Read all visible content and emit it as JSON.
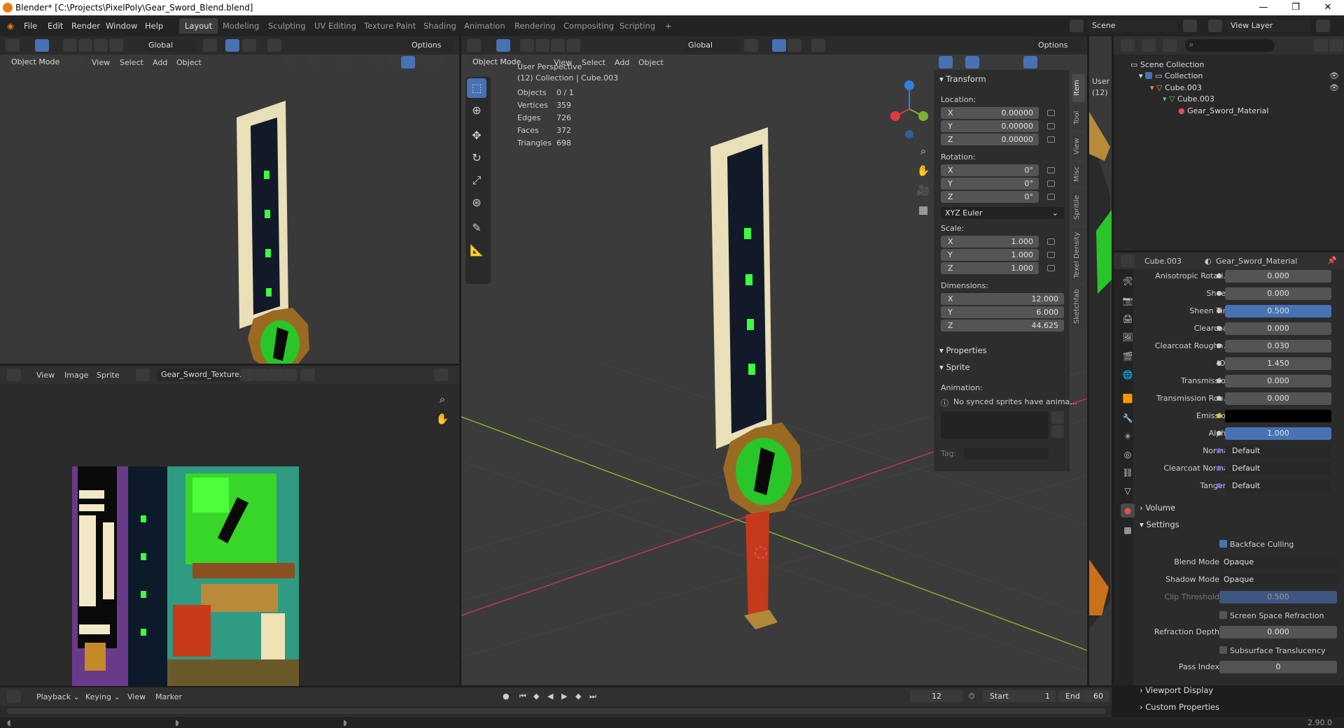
{
  "window": {
    "title": "Blender* [C:\\Projects\\PixelPoly\\Gear_Sword_Blend.blend]",
    "minimize": "—",
    "maximize": "❐",
    "close": "✕"
  },
  "menus": [
    "File",
    "Edit",
    "Render",
    "Window",
    "Help"
  ],
  "workspaces": [
    "Layout",
    "Modeling",
    "Sculpting",
    "UV Editing",
    "Texture Paint",
    "Shading",
    "Animation",
    "Rendering",
    "Compositing",
    "Scripting",
    "+"
  ],
  "scene": {
    "label": "Scene",
    "view_layer": "View Layer"
  },
  "left_viewport": {
    "transform": "Global",
    "options": "Options",
    "mode": "Object Mode",
    "menus": [
      "View",
      "Select",
      "Add",
      "Object"
    ]
  },
  "image_editor": {
    "menus": [
      "View",
      "Image",
      "Sprite"
    ],
    "image_name": "Gear_Sword_Texture..."
  },
  "main_viewport": {
    "transform": "Global",
    "options": "Options",
    "mode": "Object Mode",
    "menus": [
      "View",
      "Select",
      "Add",
      "Object"
    ],
    "perspective": "User Perspective",
    "collection": "(12) Collection | Cube.003",
    "stats": [
      {
        "k": "Objects",
        "v": "0 / 1"
      },
      {
        "k": "Vertices",
        "v": "359"
      },
      {
        "k": "Edges",
        "v": "726"
      },
      {
        "k": "Faces",
        "v": "372"
      },
      {
        "k": "Triangles",
        "v": "698"
      }
    ],
    "gizmo_colors": {
      "x": "#e0393e",
      "y": "#7ab332",
      "z": "#2f7fe0"
    }
  },
  "npanel": {
    "transform_title": "Transform",
    "location_label": "Location:",
    "location": [
      {
        "axis": "X",
        "value": "0.00000"
      },
      {
        "axis": "Y",
        "value": "0.00000"
      },
      {
        "axis": "Z",
        "value": "0.00000"
      }
    ],
    "rotation_label": "Rotation:",
    "rotation": [
      {
        "axis": "X",
        "value": "0°"
      },
      {
        "axis": "Y",
        "value": "0°"
      },
      {
        "axis": "Z",
        "value": "0°"
      }
    ],
    "rotation_mode": "XYZ Euler",
    "scale_label": "Scale:",
    "scale": [
      {
        "axis": "X",
        "value": "1.000"
      },
      {
        "axis": "Y",
        "value": "1.000"
      },
      {
        "axis": "Z",
        "value": "1.000"
      }
    ],
    "dimensions_label": "Dimensions:",
    "dimensions": [
      {
        "axis": "X",
        "value": "12.000"
      },
      {
        "axis": "Y",
        "value": "6.000"
      },
      {
        "axis": "Z",
        "value": "44.625"
      }
    ],
    "properties_title": "Properties",
    "sprite_title": "Sprite",
    "animation_label": "Animation:",
    "no_sprites": "No synced sprites have anima...",
    "tag_label": "Tag:",
    "tabs": [
      "Item",
      "Tool",
      "View",
      "Misc",
      "Spritile",
      "Texel Density",
      "Sketchfab"
    ]
  },
  "outliner": {
    "viewport_label": "User",
    "viewport_label2": "(12)",
    "items": [
      {
        "label": "Scene Collection"
      },
      {
        "label": "Collection"
      },
      {
        "label": "Cube.003"
      },
      {
        "label": "Cube.003"
      },
      {
        "label": "Gear_Sword_Material"
      }
    ]
  },
  "properties": {
    "object": "Cube.003",
    "material": "Gear_Sword_Material",
    "rows": [
      {
        "label": "Anisotropic Rotati...",
        "value": "0.000"
      },
      {
        "label": "Sheen",
        "value": "0.000"
      },
      {
        "label": "Sheen Tint",
        "value": "0.500"
      },
      {
        "label": "Clearcoat",
        "value": "0.000"
      },
      {
        "label": "Clearcoat Roughn...",
        "value": "0.030"
      },
      {
        "label": "IOR",
        "value": "1.450"
      },
      {
        "label": "Transmission",
        "value": "0.000"
      },
      {
        "label": "Transmission Rou...",
        "value": "0.000"
      },
      {
        "label": "Emission",
        "value": ""
      },
      {
        "label": "Alpha",
        "value": "1.000"
      },
      {
        "label": "Normal",
        "value": "Default"
      },
      {
        "label": "Clearcoat Normal",
        "value": "Default"
      },
      {
        "label": "Tangent",
        "value": "Default"
      }
    ],
    "volume": "Volume",
    "settings": "Settings",
    "backface": "Backface Culling",
    "blend_mode_label": "Blend Mode",
    "blend_mode": "Opaque",
    "shadow_mode_label": "Shadow Mode",
    "shadow_mode": "Opaque",
    "clip_label": "Clip Threshold",
    "clip": "0.500",
    "ssr": "Screen Space Refraction",
    "refraction_label": "Refraction Depth",
    "refraction": "0.000",
    "sss": "Subsurface Translucency",
    "pass_label": "Pass Index",
    "pass": "0",
    "viewport_display": "Viewport Display",
    "custom_props": "Custom Properties"
  },
  "timeline": {
    "menus": [
      "Playback",
      "Keying",
      "View",
      "Marker"
    ],
    "frame": "12",
    "start_label": "Start",
    "start": "1",
    "end_label": "End",
    "end": "60"
  },
  "version": "2.90.0"
}
